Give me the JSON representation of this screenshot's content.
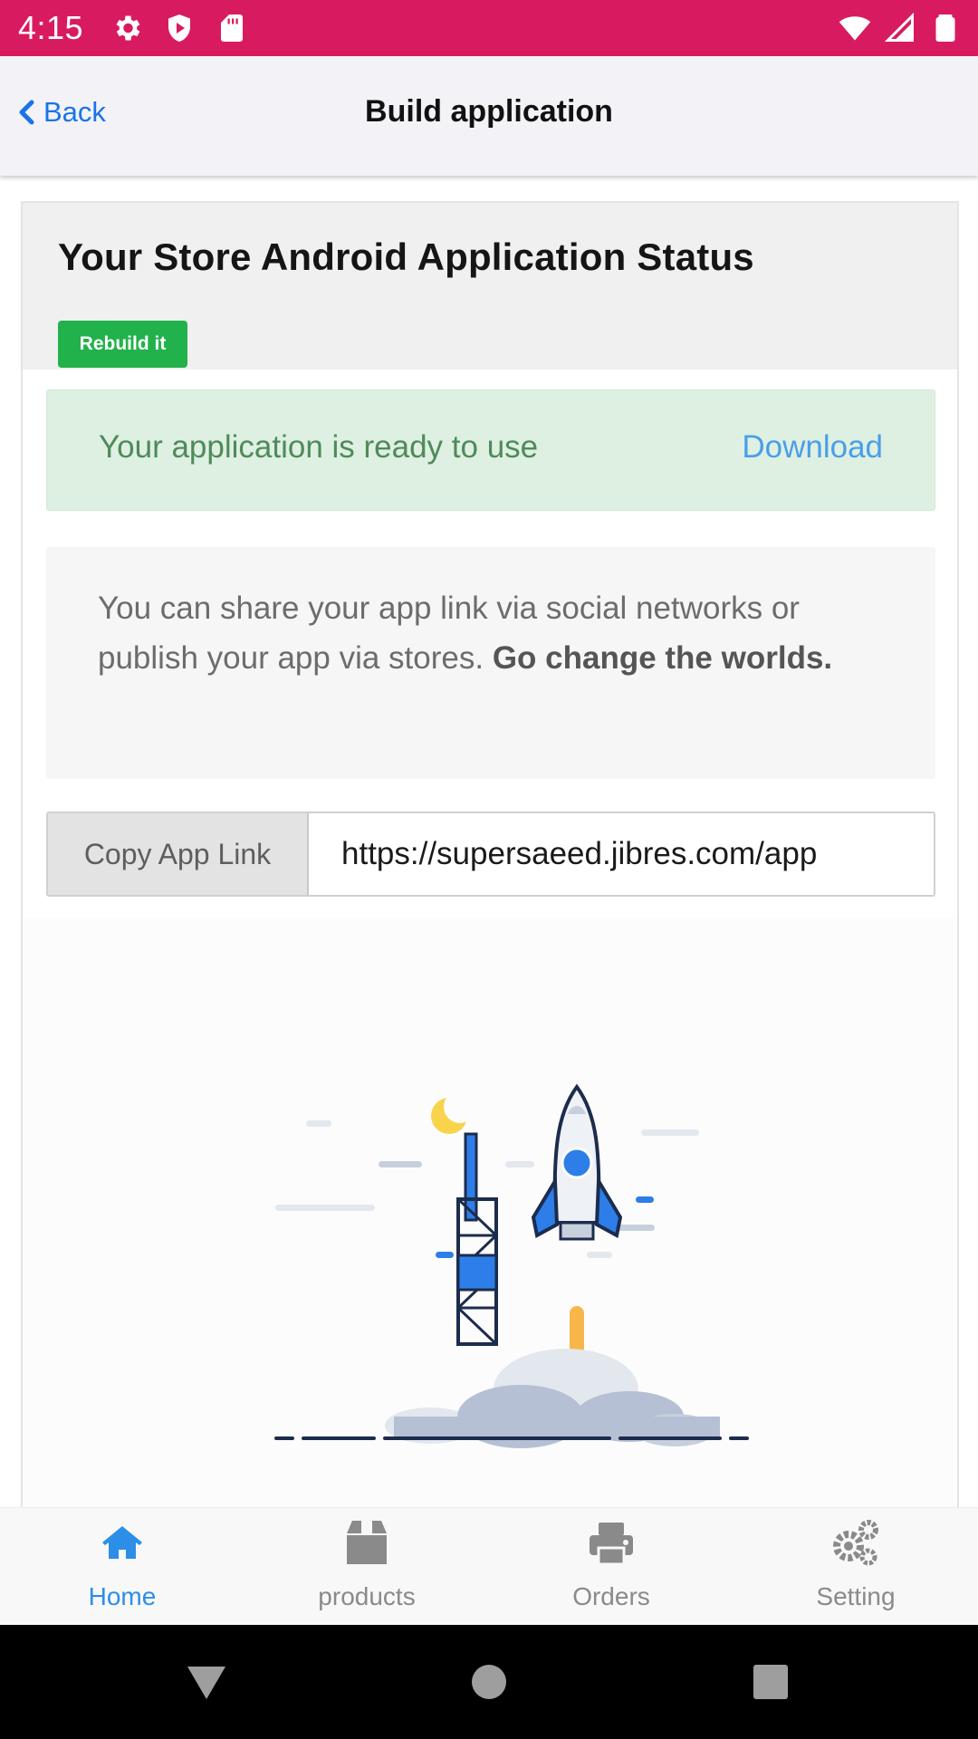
{
  "status_bar": {
    "time": "4:15",
    "left_icons": [
      "gear-icon",
      "shield-play-icon",
      "sd-card-icon"
    ],
    "right_icons": [
      "wifi-icon",
      "signal-icon",
      "battery-icon"
    ],
    "background": "#d81b60"
  },
  "header": {
    "back_label": "Back",
    "title": "Build application"
  },
  "card": {
    "title": "Your Store Android Application Status",
    "rebuild_label": "Rebuild it",
    "alert": {
      "message": "Your application is ready to use",
      "download_label": "Download"
    },
    "share": {
      "text": "You can share your app link via social networks or publish your app via stores.",
      "emphasis": "Go change the worlds."
    },
    "copy": {
      "button_label": "Copy App Link",
      "link": "https://supersaeed.jibres.com/app"
    },
    "illustration": "rocket-launch-illustration"
  },
  "bottom_nav": {
    "items": [
      {
        "label": "Home",
        "icon": "home-icon",
        "active": true
      },
      {
        "label": "products",
        "icon": "box-icon",
        "active": false
      },
      {
        "label": "Orders",
        "icon": "printer-icon",
        "active": false
      },
      {
        "label": "Setting",
        "icon": "gears-icon",
        "active": false
      }
    ],
    "active_color": "#2d8ee8"
  },
  "system_nav": [
    "back-triangle-icon",
    "home-circle-icon",
    "recents-square-icon"
  ],
  "colors": {
    "accent_blue": "#1a73e8",
    "success_green": "#21b24b",
    "alert_bg": "#def0e1"
  }
}
